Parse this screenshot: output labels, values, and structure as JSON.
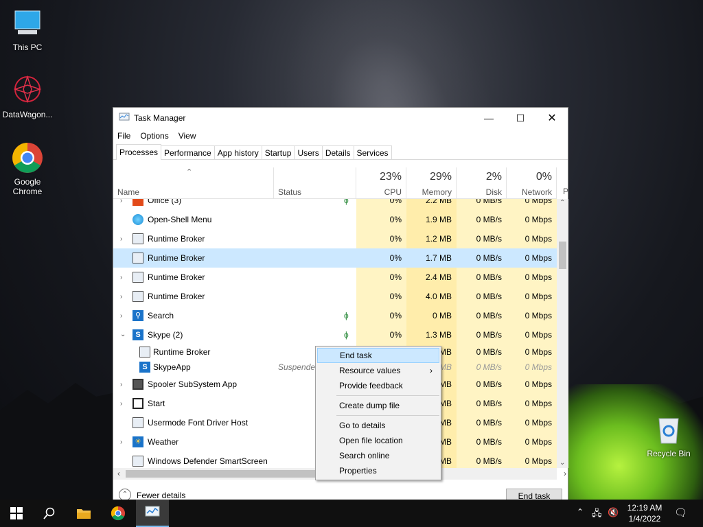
{
  "desktop": {
    "icons": [
      {
        "label": "This PC"
      },
      {
        "label": "DataWagon..."
      },
      {
        "label": "Google Chrome"
      },
      {
        "label": "Recycle Bin"
      }
    ]
  },
  "window": {
    "title": "Task Manager",
    "menu": [
      "File",
      "Options",
      "View"
    ],
    "tabs": [
      "Processes",
      "Performance",
      "App history",
      "Startup",
      "Users",
      "Details",
      "Services"
    ],
    "columns": {
      "name": "Name",
      "status": "Status",
      "cpu_pct": "23%",
      "cpu": "CPU",
      "mem_pct": "29%",
      "mem": "Memory",
      "disk_pct": "2%",
      "disk": "Disk",
      "net_pct": "0%",
      "net": "Network",
      "power": "P"
    },
    "rows": [
      {
        "name": "Office (3)",
        "status": "",
        "cpu": "0%",
        "mem": "2.2 MB",
        "disk": "0 MB/s",
        "net": "0 Mbps"
      },
      {
        "name": "Open-Shell Menu",
        "status": "",
        "cpu": "0%",
        "mem": "1.9 MB",
        "disk": "0 MB/s",
        "net": "0 Mbps"
      },
      {
        "name": "Runtime Broker",
        "status": "",
        "cpu": "0%",
        "mem": "1.2 MB",
        "disk": "0 MB/s",
        "net": "0 Mbps"
      },
      {
        "name": "Runtime Broker",
        "status": "",
        "cpu": "0%",
        "mem": "1.7 MB",
        "disk": "0 MB/s",
        "net": "0 Mbps"
      },
      {
        "name": "Runtime Broker",
        "status": "",
        "cpu": "0%",
        "mem": "2.4 MB",
        "disk": "0 MB/s",
        "net": "0 Mbps"
      },
      {
        "name": "Runtime Broker",
        "status": "",
        "cpu": "0%",
        "mem": "4.0 MB",
        "disk": "0 MB/s",
        "net": "0 Mbps"
      },
      {
        "name": "Search",
        "status": "",
        "cpu": "0%",
        "mem": "0 MB",
        "disk": "0 MB/s",
        "net": "0 Mbps"
      },
      {
        "name": "Skype (2)",
        "status": "",
        "cpu": "0%",
        "mem": "1.3 MB",
        "disk": "0 MB/s",
        "net": "0 Mbps"
      },
      {
        "name": "Runtime Broker",
        "status": "",
        "cpu": "",
        "mem": "MB",
        "disk": "0 MB/s",
        "net": "0 Mbps"
      },
      {
        "name": "SkypeApp",
        "status": "Suspended",
        "cpu": "",
        "mem": "MB",
        "disk": "0 MB/s",
        "net": "0 Mbps"
      },
      {
        "name": "Spooler SubSystem App",
        "status": "",
        "cpu": "",
        "mem": "MB",
        "disk": "0 MB/s",
        "net": "0 Mbps"
      },
      {
        "name": "Start",
        "status": "",
        "cpu": "",
        "mem": "MB",
        "disk": "0 MB/s",
        "net": "0 Mbps"
      },
      {
        "name": "Usermode Font Driver Host",
        "status": "",
        "cpu": "",
        "mem": "MB",
        "disk": "0 MB/s",
        "net": "0 Mbps"
      },
      {
        "name": "Weather",
        "status": "",
        "cpu": "",
        "mem": "MB",
        "disk": "0 MB/s",
        "net": "0 Mbps"
      },
      {
        "name": "Windows Defender SmartScreen",
        "status": "",
        "cpu": "",
        "mem": "MB",
        "disk": "0 MB/s",
        "net": "0 Mbps"
      }
    ],
    "fewer_details": "Fewer details",
    "end_task": "End task"
  },
  "context_menu": {
    "items": [
      "End task",
      "Resource values",
      "Provide feedback",
      "Create dump file",
      "Go to details",
      "Open file location",
      "Search online",
      "Properties"
    ]
  },
  "taskbar": {
    "time": "12:19 AM",
    "date": "1/4/2022"
  }
}
